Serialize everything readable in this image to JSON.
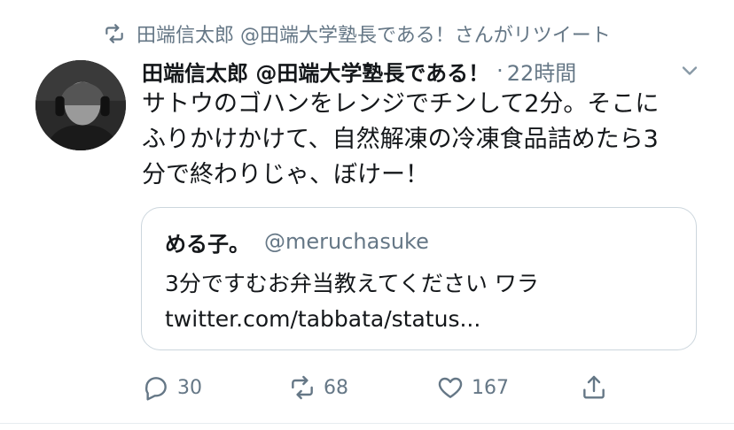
{
  "retweet_context": {
    "text": "田端信太郎 @田端大学塾長である！さんがリツイート",
    "icon": "retweet-icon"
  },
  "tweet": {
    "display_name": "田端信太郎 @田端大学塾長である！",
    "separator": "·",
    "time": "22時間",
    "text_lines": [
      "サトウのゴハンをレンジでチンして2分。そこに",
      "ふりかけかけて、自然解凍の冷凍食品詰めたら3",
      "分で終わりじゃ、ぼけー！"
    ],
    "caret_icon": "chevron-down-icon",
    "avatar_icon": "avatar"
  },
  "quoted_tweet": {
    "name": "める子。",
    "handle": "@meruchasuke",
    "text_lines": [
      "3分ですむお弁当教えてください ワラ",
      "twitter.com/tabbata/status..."
    ]
  },
  "actions": {
    "reply": {
      "icon": "reply-icon",
      "count": "30"
    },
    "retweet": {
      "icon": "retweet-icon",
      "count": "68"
    },
    "like": {
      "icon": "heart-icon",
      "count": "167"
    },
    "share": {
      "icon": "share-icon"
    }
  },
  "colors": {
    "text": "#14171a",
    "secondary": "#657786",
    "border": "#ccd6dd"
  }
}
